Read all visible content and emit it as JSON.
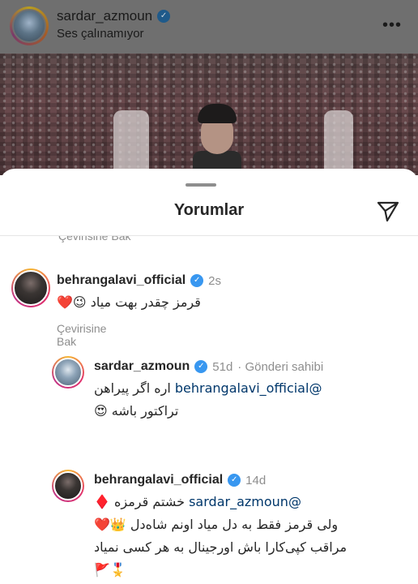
{
  "post": {
    "username": "sardar_azmoun",
    "audio": "Ses çalınamıyor",
    "more": "•••"
  },
  "sheet": {
    "title": "Yorumlar",
    "partial_see_translation": "Çevirisine Bak"
  },
  "comments": [
    {
      "username": "behrangalavi_official",
      "time": "2s",
      "text": "قرمز چقدر بهت میاد 😉❤️",
      "see_translation": "Çevirisine Bak"
    },
    {
      "username": "sardar_azmoun",
      "time": "51d",
      "owner_label": "· Gönderi sahibi",
      "mention": "@behrangalavi_official",
      "text_line1": "اره اگر پیراهن",
      "text_line2": "تراکتور باشه 😍"
    },
    {
      "username": "behrangalavi_official",
      "time": "14d",
      "mention": "@sardar_azmoun",
      "text_line1": "خشتم قرمزه ♦️",
      "text_line2": "ولی قرمز فقط به دل میاد اونم شاه‌دل 👑❤️",
      "text_line3": "مراقب کپی‌کارا باش اورجینال به هر کسی نمیاد",
      "text_line4": "🎖️🚩"
    }
  ],
  "colors": {
    "verified": "#3897f0",
    "mention": "#00376b",
    "secondary_text": "#8e8e8e"
  },
  "icons": [
    "more-icon",
    "verified-icon",
    "share-icon"
  ]
}
